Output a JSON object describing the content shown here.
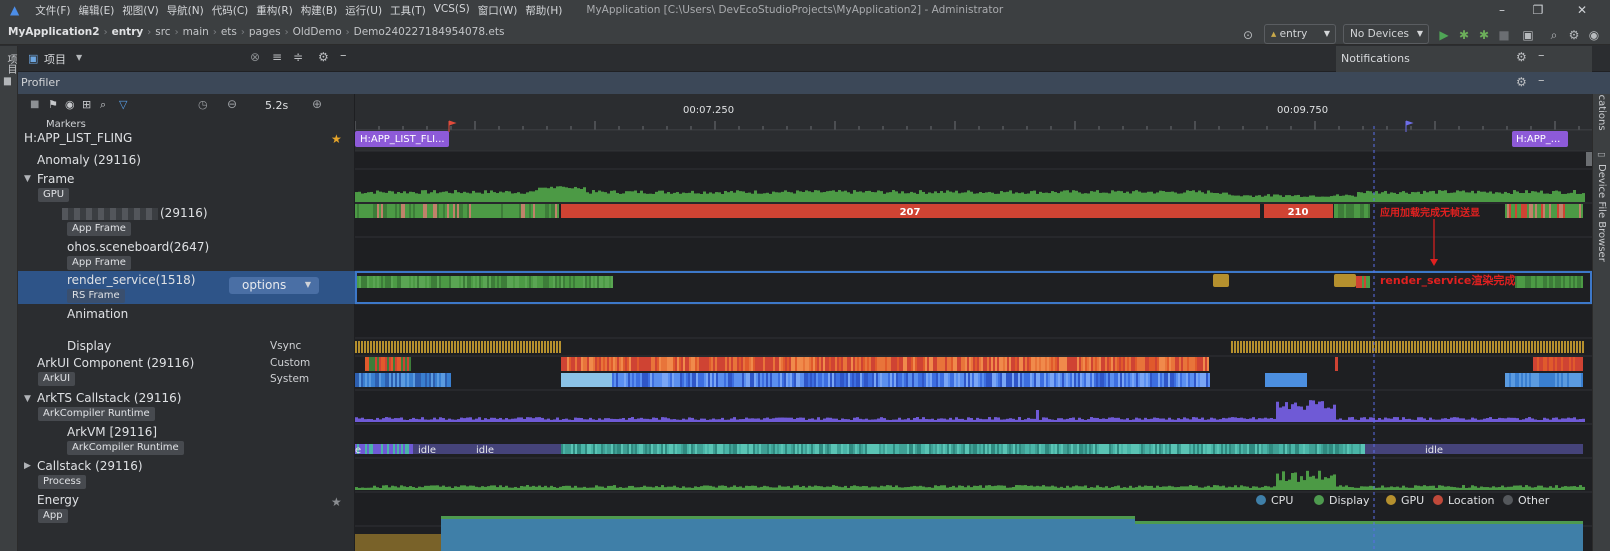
{
  "menu": [
    "文件(F)",
    "编辑(E)",
    "视图(V)",
    "导航(N)",
    "代码(C)",
    "重构(R)",
    "构建(B)",
    "运行(U)",
    "工具(T)",
    "VCS(S)",
    "窗口(W)",
    "帮助(H)"
  ],
  "window_title": "MyApplication [C:\\Users\\           DevEcoStudioProjects\\MyApplication2] - Administrator",
  "breadcrumbs": [
    "MyApplication2",
    "entry",
    "src",
    "main",
    "ets",
    "pages",
    "OldDemo",
    "Demo240227184954078.ets"
  ],
  "run_config": "entry",
  "device_selector": "No Devices",
  "project_panel_label": "项目",
  "profiler_title": "Profiler",
  "notifications_title": "Notifications",
  "left_strip_label": "项目",
  "right_strip_labels": [
    "Notifications",
    "Device File Browser"
  ],
  "zoom_value": "5.2s",
  "time_ticks": [
    "00:07.250",
    "00:09.750"
  ],
  "markers_label": "Markers",
  "marker_track": {
    "name": "H:APP_LIST_FLING",
    "chip1": "H:APP_LIST_FLI...",
    "chip2": "H:APP_..."
  },
  "rows": {
    "anomaly": "Anomaly (29116)",
    "frame": {
      "name": "Frame",
      "badge": "GPU"
    },
    "app_process": {
      "name": "(29116)",
      "badge": "App Frame",
      "bars": [
        "207",
        "210"
      ],
      "note": "应用加载完成无帧送显"
    },
    "sceneboard": {
      "name": "ohos.sceneboard(2647)",
      "badge": "App Frame"
    },
    "render_service": {
      "name": "render_service(1518)",
      "badge": "RS Frame",
      "options": "options",
      "note": "render_service渲染完成"
    },
    "animation": "Animation",
    "display": {
      "name": "Display",
      "sub": "Vsync"
    },
    "arkui": {
      "name": "ArkUI Component (29116)",
      "badge": "ArkUI",
      "subs": [
        "Custom",
        "System"
      ]
    },
    "arkts": {
      "name": "ArkTS Callstack (29116)",
      "badge": "ArkCompiler Runtime"
    },
    "arkvm": {
      "name": "ArkVM [29116]",
      "badge": "ArkCompiler Runtime",
      "labels": [
        "e",
        "idle",
        "idle",
        "idle"
      ]
    },
    "callstack": {
      "name": "Callstack (29116)",
      "badge": "Process"
    },
    "energy": {
      "name": "Energy",
      "badge": "App"
    }
  },
  "energy_legend": [
    {
      "label": "CPU",
      "color": "#3f7fa8"
    },
    {
      "label": "Display",
      "color": "#4e9a4f"
    },
    {
      "label": "GPU",
      "color": "#b5902e"
    },
    {
      "label": "Location",
      "color": "#c0493a"
    },
    {
      "label": "Other",
      "color": "#55585c"
    }
  ],
  "colors": {
    "frame_green": "#4c9a45",
    "jank_red": "#cf4333",
    "selection_blue": "#3d78c9",
    "callstack_purple": "#6f5ad6",
    "annotation_red": "#e02020"
  }
}
